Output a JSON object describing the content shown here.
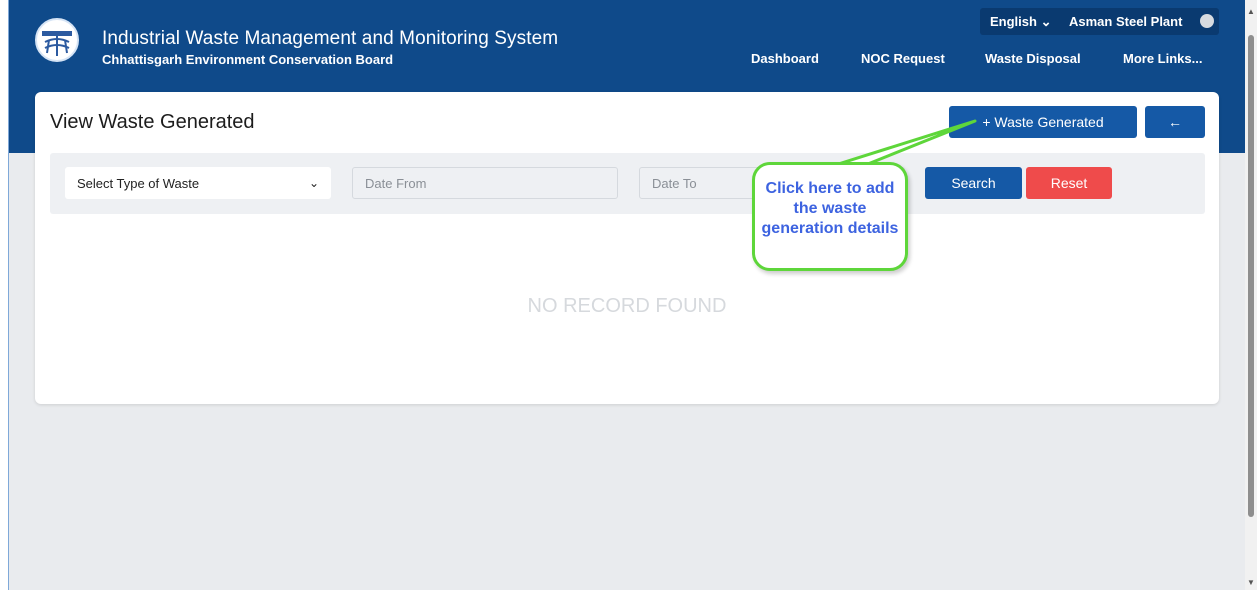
{
  "header": {
    "title": "Industrial Waste Management and Monitoring System",
    "subtitle": "Chhattisgarh Environment Conservation Board",
    "language": "English",
    "language_chevron": "⌄",
    "user": "Asman Steel Plant",
    "nav": [
      "Dashboard",
      "NOC Request",
      "Waste Disposal",
      "More Links..."
    ]
  },
  "page": {
    "title": "View Waste Generated",
    "add_button": "+ Waste Generated",
    "back_button": "←"
  },
  "filters": {
    "waste_type": "Select Type of Waste",
    "date_from_placeholder": "Date From",
    "date_to_placeholder": "Date To",
    "search": "Search",
    "reset": "Reset"
  },
  "empty_message": "NO RECORD FOUND",
  "callout": {
    "text": "Click here to add the waste generation details"
  },
  "colors": {
    "header": "#0f4a8a",
    "primary": "#1559a6",
    "danger": "#ef4b4b",
    "callout_border": "#5ed63a",
    "callout_text": "#3d63e0"
  }
}
